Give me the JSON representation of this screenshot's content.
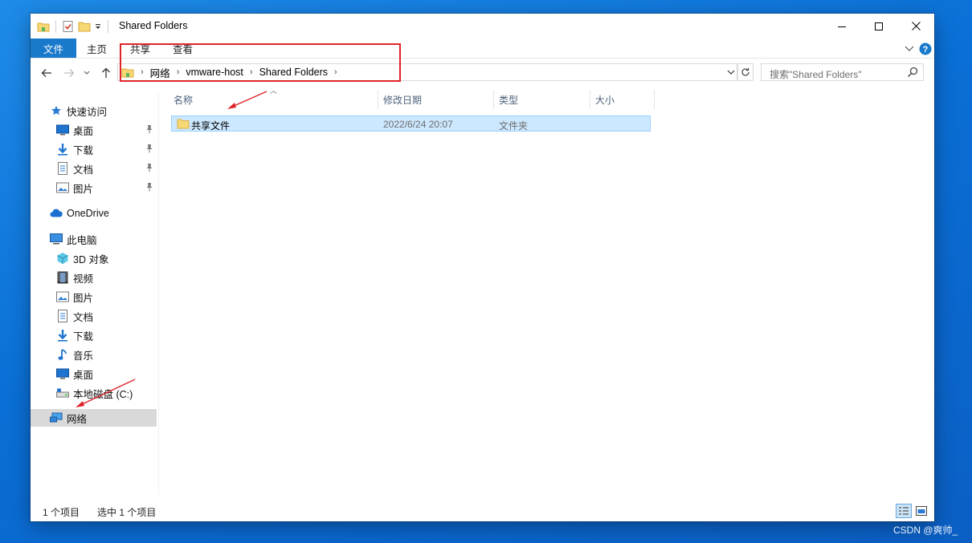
{
  "window": {
    "title": "Shared Folders"
  },
  "ribbon": {
    "tabs": [
      "文件",
      "主页",
      "共享",
      "查看"
    ]
  },
  "address": {
    "crumbs": [
      "网络",
      "vmware-host",
      "Shared Folders"
    ]
  },
  "search": {
    "placeholder": "搜索\"Shared Folders\""
  },
  "nav": {
    "quick_access": "快速访问",
    "quick_items": [
      "桌面",
      "下载",
      "文档",
      "图片"
    ],
    "onedrive": "OneDrive",
    "this_pc": "此电脑",
    "pc_items": [
      "3D 对象",
      "视频",
      "图片",
      "文档",
      "下载",
      "音乐",
      "桌面",
      "本地磁盘 (C:)"
    ],
    "network": "网络"
  },
  "columns": [
    "名称",
    "修改日期",
    "类型",
    "大小"
  ],
  "files": [
    {
      "name": "共享文件",
      "modified": "2022/6/24 20:07",
      "type": "文件夹",
      "size": ""
    }
  ],
  "status": {
    "count": "1 个项目",
    "selected": "选中 1 个项目"
  },
  "watermark": "CSDN @爽帅_",
  "colors": {
    "accent": "#1979ca",
    "selection": "#cce8ff",
    "highlight_red": "#e0242a"
  },
  "icons": [
    "folder-icon",
    "check-doc-icon",
    "dropdown-icon",
    "minimize-icon",
    "maximize-icon",
    "close-icon",
    "chevron-down-icon",
    "help-icon",
    "back-arrow-icon",
    "forward-arrow-icon",
    "up-arrow-icon",
    "refresh-icon",
    "search-icon",
    "star-icon",
    "desktop-icon",
    "download-icon",
    "document-icon",
    "picture-icon",
    "pin-icon",
    "cloud-icon",
    "computer-icon",
    "3d-cube-icon",
    "video-icon",
    "music-icon",
    "drive-icon",
    "network-icon",
    "details-view-icon",
    "large-icons-view-icon"
  ]
}
